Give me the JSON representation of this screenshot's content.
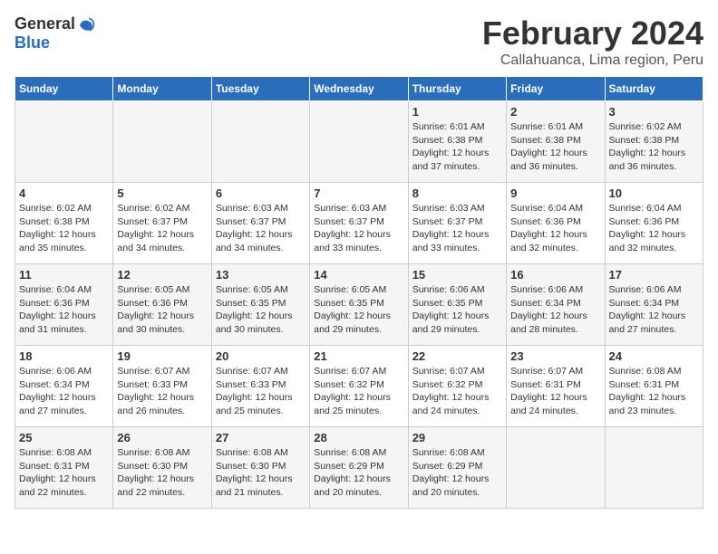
{
  "header": {
    "logo_general": "General",
    "logo_blue": "Blue",
    "month_title": "February 2024",
    "location": "Callahuanca, Lima region, Peru"
  },
  "weekdays": [
    "Sunday",
    "Monday",
    "Tuesday",
    "Wednesday",
    "Thursday",
    "Friday",
    "Saturday"
  ],
  "weeks": [
    [
      {
        "day": "",
        "info": ""
      },
      {
        "day": "",
        "info": ""
      },
      {
        "day": "",
        "info": ""
      },
      {
        "day": "",
        "info": ""
      },
      {
        "day": "1",
        "info": "Sunrise: 6:01 AM\nSunset: 6:38 PM\nDaylight: 12 hours and 37 minutes."
      },
      {
        "day": "2",
        "info": "Sunrise: 6:01 AM\nSunset: 6:38 PM\nDaylight: 12 hours and 36 minutes."
      },
      {
        "day": "3",
        "info": "Sunrise: 6:02 AM\nSunset: 6:38 PM\nDaylight: 12 hours and 36 minutes."
      }
    ],
    [
      {
        "day": "4",
        "info": "Sunrise: 6:02 AM\nSunset: 6:38 PM\nDaylight: 12 hours and 35 minutes."
      },
      {
        "day": "5",
        "info": "Sunrise: 6:02 AM\nSunset: 6:37 PM\nDaylight: 12 hours and 34 minutes."
      },
      {
        "day": "6",
        "info": "Sunrise: 6:03 AM\nSunset: 6:37 PM\nDaylight: 12 hours and 34 minutes."
      },
      {
        "day": "7",
        "info": "Sunrise: 6:03 AM\nSunset: 6:37 PM\nDaylight: 12 hours and 33 minutes."
      },
      {
        "day": "8",
        "info": "Sunrise: 6:03 AM\nSunset: 6:37 PM\nDaylight: 12 hours and 33 minutes."
      },
      {
        "day": "9",
        "info": "Sunrise: 6:04 AM\nSunset: 6:36 PM\nDaylight: 12 hours and 32 minutes."
      },
      {
        "day": "10",
        "info": "Sunrise: 6:04 AM\nSunset: 6:36 PM\nDaylight: 12 hours and 32 minutes."
      }
    ],
    [
      {
        "day": "11",
        "info": "Sunrise: 6:04 AM\nSunset: 6:36 PM\nDaylight: 12 hours and 31 minutes."
      },
      {
        "day": "12",
        "info": "Sunrise: 6:05 AM\nSunset: 6:36 PM\nDaylight: 12 hours and 30 minutes."
      },
      {
        "day": "13",
        "info": "Sunrise: 6:05 AM\nSunset: 6:35 PM\nDaylight: 12 hours and 30 minutes."
      },
      {
        "day": "14",
        "info": "Sunrise: 6:05 AM\nSunset: 6:35 PM\nDaylight: 12 hours and 29 minutes."
      },
      {
        "day": "15",
        "info": "Sunrise: 6:06 AM\nSunset: 6:35 PM\nDaylight: 12 hours and 29 minutes."
      },
      {
        "day": "16",
        "info": "Sunrise: 6:06 AM\nSunset: 6:34 PM\nDaylight: 12 hours and 28 minutes."
      },
      {
        "day": "17",
        "info": "Sunrise: 6:06 AM\nSunset: 6:34 PM\nDaylight: 12 hours and 27 minutes."
      }
    ],
    [
      {
        "day": "18",
        "info": "Sunrise: 6:06 AM\nSunset: 6:34 PM\nDaylight: 12 hours and 27 minutes."
      },
      {
        "day": "19",
        "info": "Sunrise: 6:07 AM\nSunset: 6:33 PM\nDaylight: 12 hours and 26 minutes."
      },
      {
        "day": "20",
        "info": "Sunrise: 6:07 AM\nSunset: 6:33 PM\nDaylight: 12 hours and 25 minutes."
      },
      {
        "day": "21",
        "info": "Sunrise: 6:07 AM\nSunset: 6:32 PM\nDaylight: 12 hours and 25 minutes."
      },
      {
        "day": "22",
        "info": "Sunrise: 6:07 AM\nSunset: 6:32 PM\nDaylight: 12 hours and 24 minutes."
      },
      {
        "day": "23",
        "info": "Sunrise: 6:07 AM\nSunset: 6:31 PM\nDaylight: 12 hours and 24 minutes."
      },
      {
        "day": "24",
        "info": "Sunrise: 6:08 AM\nSunset: 6:31 PM\nDaylight: 12 hours and 23 minutes."
      }
    ],
    [
      {
        "day": "25",
        "info": "Sunrise: 6:08 AM\nSunset: 6:31 PM\nDaylight: 12 hours and 22 minutes."
      },
      {
        "day": "26",
        "info": "Sunrise: 6:08 AM\nSunset: 6:30 PM\nDaylight: 12 hours and 22 minutes."
      },
      {
        "day": "27",
        "info": "Sunrise: 6:08 AM\nSunset: 6:30 PM\nDaylight: 12 hours and 21 minutes."
      },
      {
        "day": "28",
        "info": "Sunrise: 6:08 AM\nSunset: 6:29 PM\nDaylight: 12 hours and 20 minutes."
      },
      {
        "day": "29",
        "info": "Sunrise: 6:08 AM\nSunset: 6:29 PM\nDaylight: 12 hours and 20 minutes."
      },
      {
        "day": "",
        "info": ""
      },
      {
        "day": "",
        "info": ""
      }
    ]
  ]
}
